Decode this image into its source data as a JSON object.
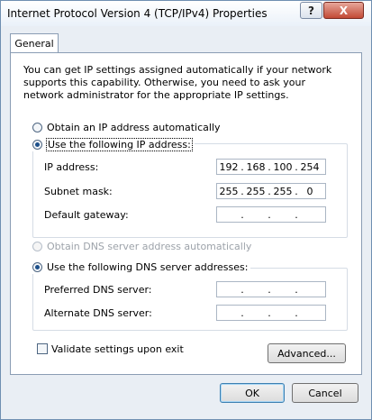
{
  "window": {
    "title": "Internet Protocol Version 4 (TCP/IPv4) Properties",
    "help_button": "?",
    "close_button": "X"
  },
  "tabs": [
    {
      "label": "General"
    }
  ],
  "description": "You can get IP settings assigned automatically if your network supports this capability. Otherwise, you need to ask your network administrator for the appropriate IP settings.",
  "ip_mode": {
    "auto_label": "Obtain an IP address automatically",
    "manual_label": "Use the following IP address:",
    "selected": "manual"
  },
  "ip_fields": {
    "ip_address": {
      "label": "IP address:",
      "octets": [
        "192",
        "168",
        "100",
        "254"
      ]
    },
    "subnet_mask": {
      "label": "Subnet mask:",
      "octets": [
        "255",
        "255",
        "255",
        "0"
      ]
    },
    "default_gateway": {
      "label": "Default gateway:",
      "octets": [
        "",
        "",
        "",
        ""
      ]
    }
  },
  "dns_mode": {
    "auto_label": "Obtain DNS server address automatically",
    "manual_label": "Use the following DNS server addresses:",
    "selected": "manual",
    "auto_disabled": true
  },
  "dns_fields": {
    "preferred": {
      "label": "Preferred DNS server:",
      "octets": [
        "",
        "",
        "",
        ""
      ]
    },
    "alternate": {
      "label": "Alternate DNS server:",
      "octets": [
        "",
        "",
        "",
        ""
      ]
    }
  },
  "validate": {
    "label": "Validate settings upon exit",
    "checked": false
  },
  "buttons": {
    "advanced": "Advanced...",
    "ok": "OK",
    "cancel": "Cancel"
  }
}
